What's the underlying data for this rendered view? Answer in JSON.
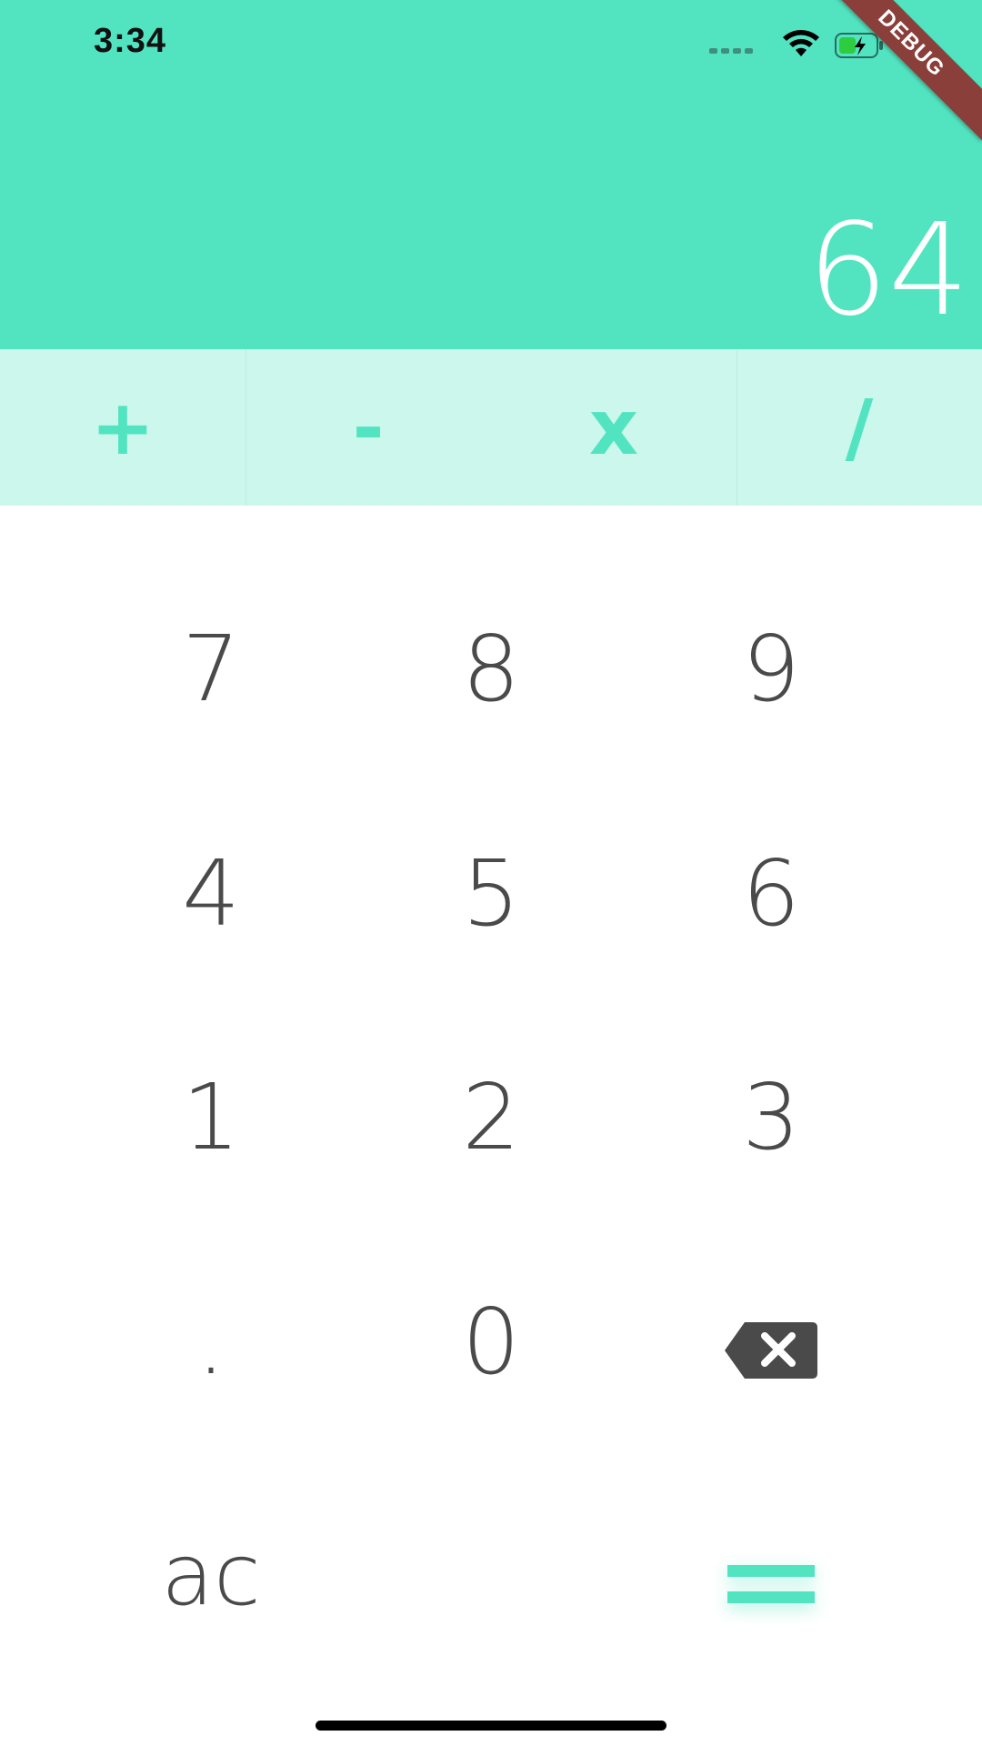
{
  "status_bar": {
    "time": "3:34"
  },
  "debug_banner": "DEBUG",
  "display": {
    "result": "64"
  },
  "operators": [
    {
      "label": "+"
    },
    {
      "label": "-"
    },
    {
      "label": "x"
    },
    {
      "label": "/"
    }
  ],
  "keypad": {
    "seven": "7",
    "eight": "8",
    "nine": "9",
    "four": "4",
    "five": "5",
    "six": "6",
    "one": "1",
    "two": "2",
    "three": "3",
    "dot": ".",
    "zero": "0",
    "clear": "ac"
  },
  "icons": {
    "backspace": "backspace-icon",
    "equals": "equals-icon"
  },
  "colors": {
    "accent": "#52E4C1",
    "operator_row": "#CBF7EC",
    "key_text": "#4A4A4A",
    "ribbon": "#8B3F3A"
  }
}
